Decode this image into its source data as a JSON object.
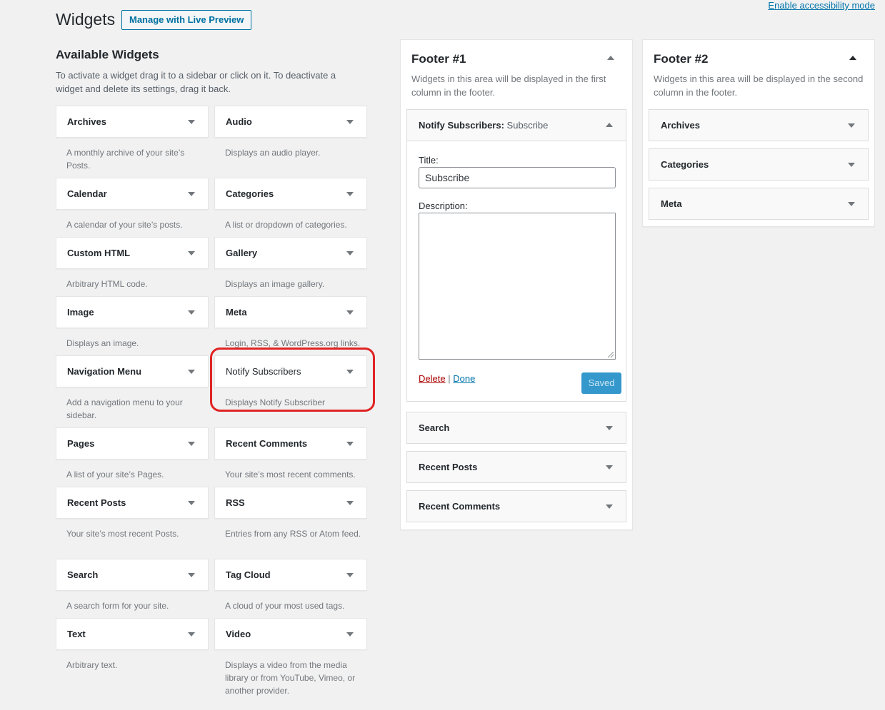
{
  "header": {
    "accessibility_link": "Enable accessibility mode",
    "title": "Widgets",
    "live_preview_button": "Manage with Live Preview"
  },
  "available": {
    "heading": "Available Widgets",
    "description": "To activate a widget drag it to a sidebar or click on it. To deactivate a widget and delete its settings, drag it back.",
    "widgets": [
      {
        "title": "Archives",
        "desc": "A monthly archive of your site’s Posts."
      },
      {
        "title": "Audio",
        "desc": "Displays an audio player."
      },
      {
        "title": "Calendar",
        "desc": "A calendar of your site’s posts."
      },
      {
        "title": "Categories",
        "desc": "A list or dropdown of categories."
      },
      {
        "title": "Custom HTML",
        "desc": "Arbitrary HTML code."
      },
      {
        "title": "Gallery",
        "desc": "Displays an image gallery."
      },
      {
        "title": "Image",
        "desc": "Displays an image."
      },
      {
        "title": "Meta",
        "desc": "Login, RSS, & WordPress.org links."
      },
      {
        "title": "Navigation Menu",
        "desc": "Add a navigation menu to your sidebar."
      },
      {
        "title": "Notify Subscribers",
        "desc": "Displays Notify Subscriber"
      },
      {
        "title": "Pages",
        "desc": "A list of your site’s Pages."
      },
      {
        "title": "Recent Comments",
        "desc": "Your site’s most recent comments."
      },
      {
        "title": "Recent Posts",
        "desc": "Your site’s most recent Posts."
      },
      {
        "title": "RSS",
        "desc": "Entries from any RSS or Atom feed."
      },
      {
        "title": "Search",
        "desc": "A search form for your site."
      },
      {
        "title": "Tag Cloud",
        "desc": "A cloud of your most used tags."
      },
      {
        "title": "Text",
        "desc": "Arbitrary text."
      },
      {
        "title": "Video",
        "desc": "Displays a video from the media library or from YouTube, Vimeo, or another provider."
      }
    ]
  },
  "footer1": {
    "name": "Footer #1",
    "description": "Widgets in this area will be displayed in the first column in the footer.",
    "open_widget": {
      "title": "Notify Subscribers:",
      "instance_title": "Subscribe",
      "title_label": "Title:",
      "title_value": "Subscribe",
      "description_label": "Description:",
      "description_value": "",
      "delete_link": "Delete",
      "separator": "|",
      "done_link": "Done",
      "saved_button": "Saved"
    },
    "widgets": [
      "Search",
      "Recent Posts",
      "Recent Comments"
    ]
  },
  "footer2": {
    "name": "Footer #2",
    "description": "Widgets in this area will be displayed in the second column in the footer.",
    "widgets": [
      "Archives",
      "Categories",
      "Meta"
    ]
  },
  "colors": {
    "accent": "#0073aa",
    "highlight": "#e02424",
    "saved_button": "#3498cc",
    "delete": "#a00000"
  }
}
